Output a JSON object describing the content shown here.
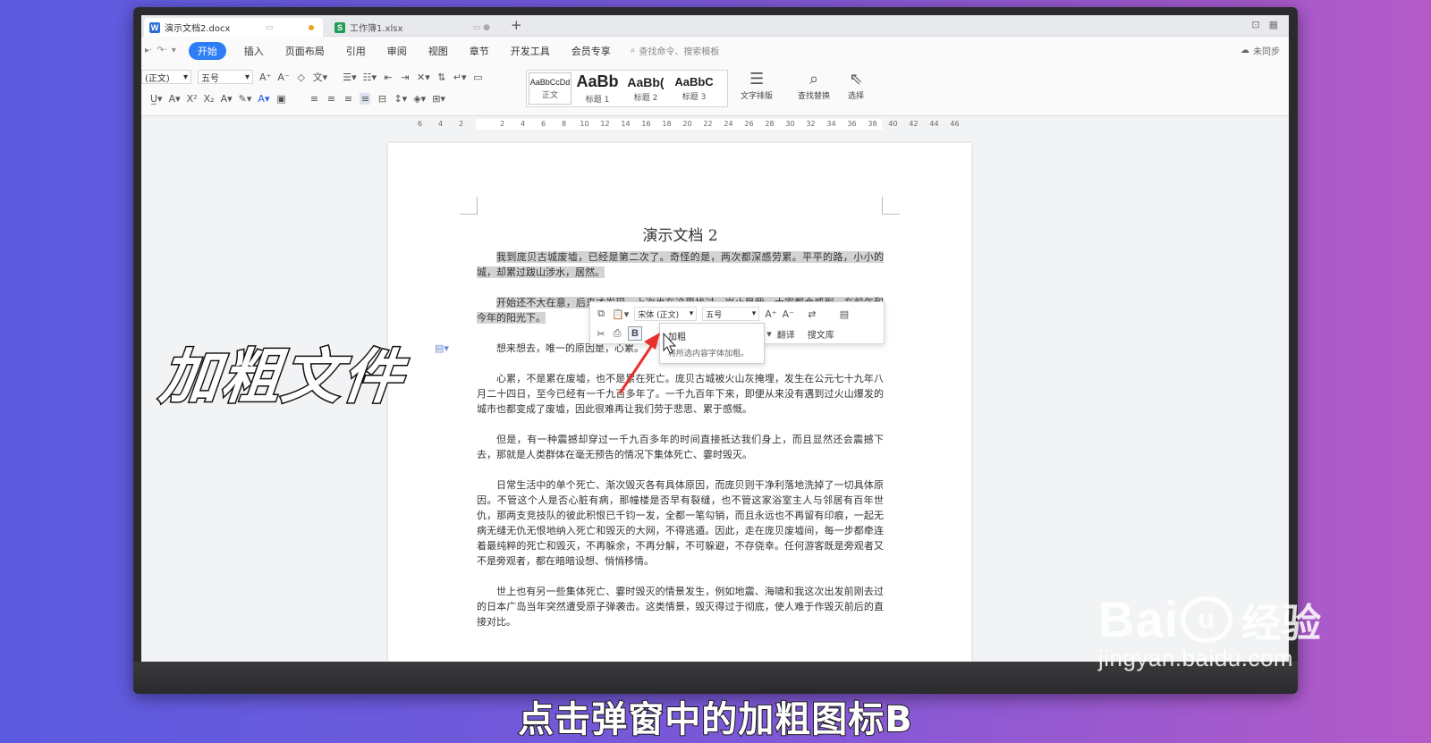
{
  "tabs": [
    {
      "label": "演示文档2.docx",
      "icon_letter": "W",
      "icon_color": "#2b6fd6"
    },
    {
      "label": "工作簿1.xlsx",
      "icon_letter": "S",
      "icon_color": "#1f9e5a"
    }
  ],
  "menu": {
    "items": [
      "开始",
      "插入",
      "页面布局",
      "引用",
      "审阅",
      "视图",
      "章节",
      "开发工具",
      "会员专享"
    ],
    "active": "开始",
    "search_placeholder": "查找命令、搜索模板",
    "sync_label": "未同步"
  },
  "ribbon": {
    "font_name": "(正文)",
    "font_size": "五号",
    "styles": [
      {
        "preview": "AaBbCcDd",
        "name": "正文"
      },
      {
        "preview": "AaBb",
        "name": "标题 1"
      },
      {
        "preview": "AaBb(",
        "name": "标题 2"
      },
      {
        "preview": "AaBbC",
        "name": "标题 3"
      }
    ],
    "text_layout_label": "文字排版",
    "find_replace_label": "查找替换",
    "select_label": "选择"
  },
  "ruler": {
    "ticks": [
      "6",
      "4",
      "2",
      "",
      "2",
      "4",
      "6",
      "8",
      "10",
      "12",
      "14",
      "16",
      "18",
      "20",
      "22",
      "24",
      "26",
      "28",
      "30",
      "32",
      "34",
      "36",
      "38",
      "40",
      "42",
      "44",
      "46"
    ]
  },
  "document": {
    "title": "演示文档 2",
    "paragraphs": [
      "我到庞贝古城废墟，已经是第二次了。奇怪的是，两次都深感劳累。平平的路，小小的城，却累过跋山涉水，居然。",
      "开始还不大在意，后来才发现，上次也在这里找过。岂止是我，大家都会感到。在前年和今年的阳光下。",
      "想来想去，唯一的原因是，心累。",
      "心累，不是累在废墟，也不是累在死亡。庞贝古城被火山灰掩埋，发生在公元七十九年八月二十四日，至今已经有一千九百多年了。一千九百年下来，即便从来没有遇到过火山爆发的城市也都变成了废墟，因此很难再让我们劳于悲思、累于感慨。",
      "但是，有一种震撼却穿过一千九百多年的时间直接抵达我们身上，而且显然还会震撼下去，那就是人类群体在毫无预告的情况下集体死亡、霎时毁灭。",
      "日常生活中的单个死亡、渐次毁灭各有具体原因，而庞贝则干净利落地洗掉了一切具体原因。不管这个人是否心脏有病，那幢楼是否早有裂缝，也不管这家浴室主人与邻居有百年世仇，那两支竞技队的彼此积恨已千钧一发，全都一笔勾销，而且永远也不再留有印痕，一起无病无缝无仇无恨地纳入死亡和毁灭的大网，不得逃遁。因此，走在庞贝废墟间，每一步都牵连着最纯粹的死亡和毁灭，不再躲余，不再分解，不可躲避，不存侥幸。任何游客既是旁观者又不是旁观者，都在暗暗设想、悄悄移情。",
      "世上也有另一些集体死亡、霎时毁灭的情景发生，例如地震、海啸和我这次出发前刚去过的日本广岛当年突然遭受原子弹袭击。这类情景，毁灭得过于彻底，使人难于作毁灭前后的直接对比。"
    ]
  },
  "float_toolbar": {
    "font_name": "宋体 (正文)",
    "font_size": "五号",
    "bold_label": "B",
    "translate_label": "翻译",
    "search_label": "搜文库"
  },
  "tooltip": {
    "title": "加粗",
    "description": "将所选内容字体加粗。"
  },
  "overlay": {
    "caption": "加粗文件",
    "subtitle": "点击弹窗中的加粗图标B"
  },
  "watermark": {
    "logo": "Bai",
    "logo_tail": "u",
    "logo_cn": "经验",
    "url": "jingyan.baidu.com"
  }
}
